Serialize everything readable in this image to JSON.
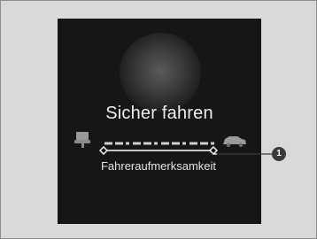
{
  "display": {
    "title": "Sicher fahren",
    "gauge_label": "Fahreraufmerksamkeit",
    "gauge_segments": 5
  },
  "callout": {
    "number": "1"
  },
  "icons": {
    "left": "driver-seat-icon",
    "right": "car-icon"
  },
  "colors": {
    "panel_bg": "#d9d9d9",
    "screen_bg": "#161616",
    "text": "#eeeeee",
    "gauge": "#cfcfcf",
    "callout": "#3a3a3a"
  }
}
